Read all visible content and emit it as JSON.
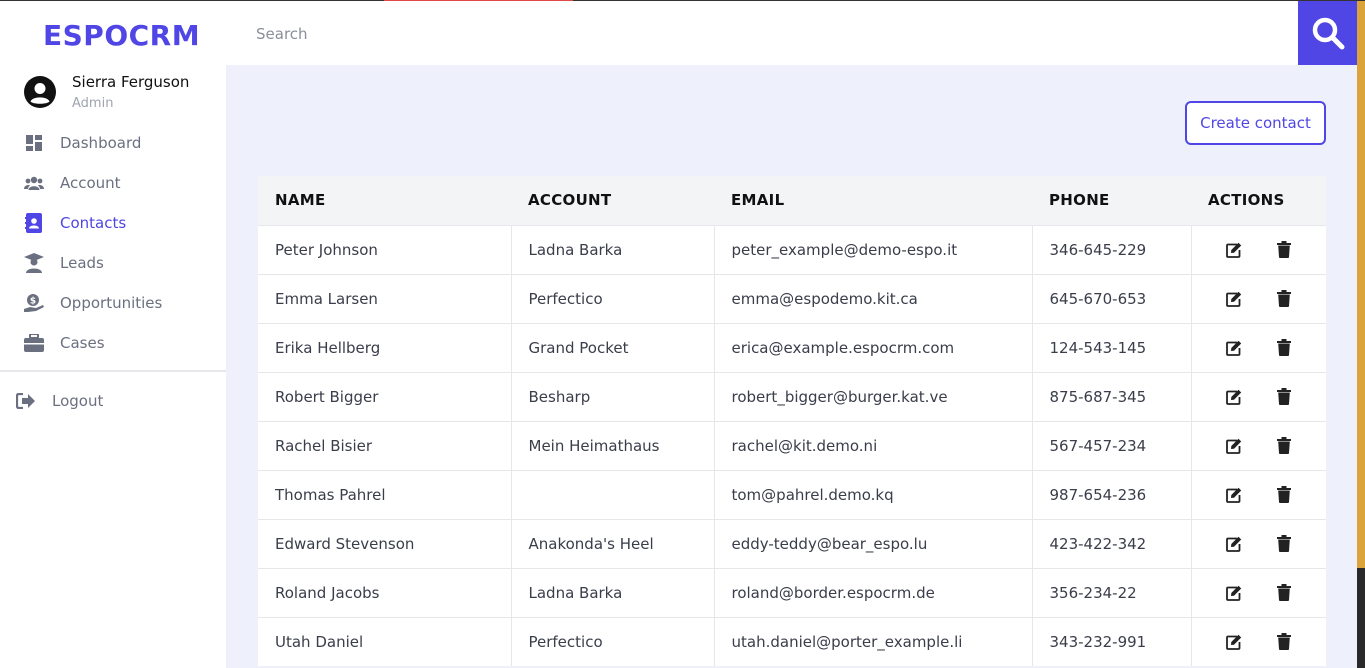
{
  "app": {
    "logo": "ESPOCRM"
  },
  "user": {
    "name": "Sierra Ferguson",
    "role": "Admin"
  },
  "sidebar": {
    "items": [
      {
        "label": "Dashboard",
        "icon": "dashboard-icon",
        "active": false
      },
      {
        "label": "Account",
        "icon": "users-icon",
        "active": false
      },
      {
        "label": "Contacts",
        "icon": "contact-card-icon",
        "active": true
      },
      {
        "label": "Leads",
        "icon": "graduate-user-icon",
        "active": false
      },
      {
        "label": "Opportunities",
        "icon": "money-hand-icon",
        "active": false
      },
      {
        "label": "Cases",
        "icon": "briefcase-icon",
        "active": false
      }
    ],
    "logout_label": "Logout"
  },
  "header": {
    "search_placeholder": "Search"
  },
  "main": {
    "create_button": "Create contact"
  },
  "colors": {
    "accent": "#4f46e5",
    "main_bg": "#eef1fb",
    "header_row_bg": "#f3f4f6"
  },
  "table": {
    "headers": [
      "NAME",
      "ACCOUNT",
      "EMAIL",
      "PHONE",
      "ACTIONS"
    ],
    "rows": [
      {
        "name": "Peter Johnson",
        "account": "Ladna Barka",
        "email": "peter_example@demo-espo.it",
        "phone": "346-645-229"
      },
      {
        "name": "Emma Larsen",
        "account": "Perfectico",
        "email": "emma@espodemo.kit.ca",
        "phone": "645-670-653"
      },
      {
        "name": "Erika Hellberg",
        "account": "Grand Pocket",
        "email": "erica@example.espocrm.com",
        "phone": "124-543-145"
      },
      {
        "name": "Robert Bigger",
        "account": "Besharp",
        "email": "robert_bigger@burger.kat.ve",
        "phone": "875-687-345"
      },
      {
        "name": "Rachel Bisier",
        "account": "Mein Heimathaus",
        "email": "rachel@kit.demo.ni",
        "phone": "567-457-234"
      },
      {
        "name": "Thomas Pahrel",
        "account": "",
        "email": "tom@pahrel.demo.kq",
        "phone": "987-654-236"
      },
      {
        "name": "Edward Stevenson",
        "account": "Anakonda's Heel",
        "email": "eddy-teddy@bear_espo.lu",
        "phone": "423-422-342"
      },
      {
        "name": "Roland Jacobs",
        "account": "Ladna Barka",
        "email": "roland@border.espocrm.de",
        "phone": "356-234-22"
      },
      {
        "name": "Utah Daniel",
        "account": "Perfectico",
        "email": "utah.daniel@porter_example.li",
        "phone": "343-232-991"
      }
    ]
  }
}
